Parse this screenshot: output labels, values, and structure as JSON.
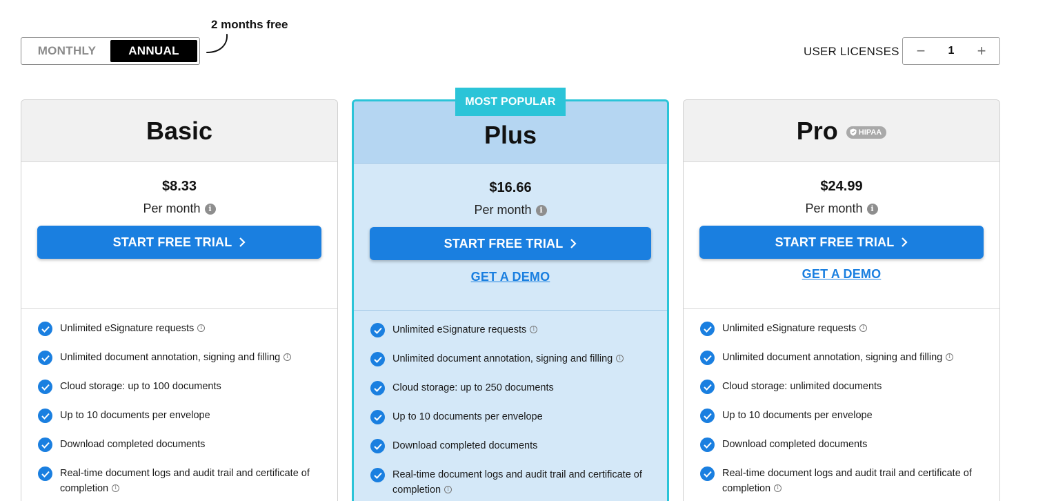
{
  "billing": {
    "monthly_label": "MONTHLY",
    "annual_label": "ANNUAL",
    "selected": "ANNUAL",
    "promo_note": "2 months free"
  },
  "licenses": {
    "label": "USER LICENSES",
    "value": "1",
    "decrement_symbol": "−",
    "increment_symbol": "+"
  },
  "badge": {
    "most_popular": "MOST POPULAR"
  },
  "colors": {
    "accent": "#1a7fe0",
    "highlight": "#2bc4d8",
    "plus_background": "#d4e8f8",
    "hipaa_badge": "#a9a9a9"
  },
  "plans": [
    {
      "name": "Basic",
      "price": "$8.33",
      "period": "Per month",
      "cta": "START FREE TRIAL",
      "features": [
        "Unlimited eSignature requests",
        "Unlimited document annotation, signing and filling",
        "Cloud storage: up to 100 documents",
        "Up to 10 documents per envelope",
        "Download completed documents",
        "Real-time document logs and audit trail and certificate of completion"
      ]
    },
    {
      "name": "Plus",
      "price": "$16.66",
      "period": "Per month",
      "cta": "START FREE TRIAL",
      "demo": "GET A DEMO",
      "features": [
        "Unlimited eSignature requests",
        "Unlimited document annotation, signing and filling",
        "Cloud storage: up to 250 documents",
        "Up to 10 documents per envelope",
        "Download completed documents",
        "Real-time document logs and audit trail and certificate of completion"
      ]
    },
    {
      "name": "Pro",
      "badge": "HIPAA",
      "price": "$24.99",
      "period": "Per month",
      "cta": "START FREE TRIAL",
      "demo": "GET A DEMO",
      "features": [
        "Unlimited eSignature requests",
        "Unlimited document annotation, signing and filling",
        "Cloud storage: unlimited documents",
        "Up to 10 documents per envelope",
        "Download completed documents",
        "Real-time document logs and audit trail and certificate of completion"
      ]
    }
  ]
}
